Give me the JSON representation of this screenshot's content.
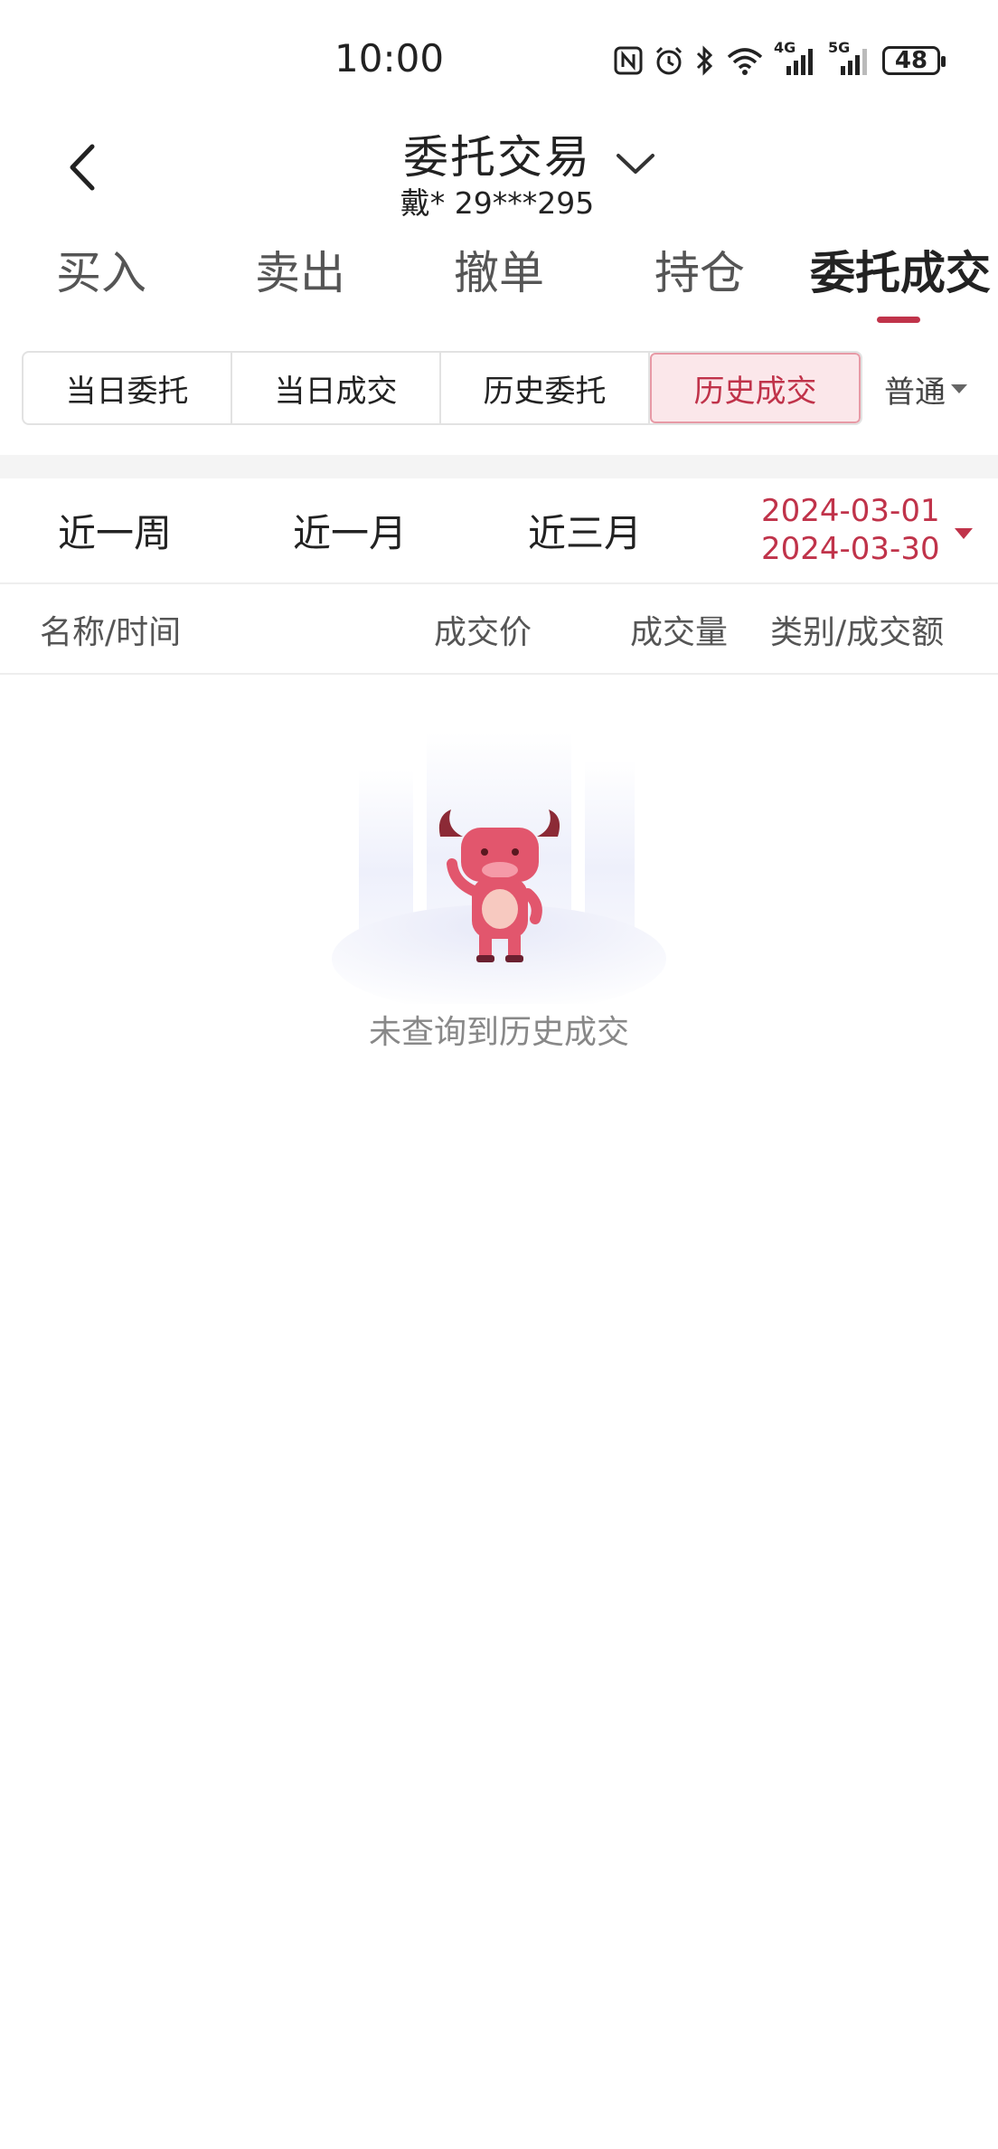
{
  "status_bar": {
    "time": "10:00",
    "icons": [
      "nfc-icon",
      "alarm-icon",
      "bluetooth-icon",
      "wifi-icon",
      "signal-4g-icon",
      "signal-5g-icon"
    ],
    "network_4g": "4G",
    "network_5g": "5G",
    "battery": "48"
  },
  "header": {
    "title": "委托交易",
    "account": "戴* 29***295"
  },
  "main_tabs": [
    "买入",
    "卖出",
    "撤单",
    "持仓",
    "委托成交"
  ],
  "active_main_tab": "委托成交",
  "sub_tabs": [
    "当日委托",
    "当日成交",
    "历史委托",
    "历史成交"
  ],
  "active_sub_tab": "历史成交",
  "account_type": "普通",
  "periods": [
    "近一周",
    "近一月",
    "近三月"
  ],
  "date_range": {
    "start": "2024-03-01",
    "end": "2024-03-30"
  },
  "columns": [
    "名称/时间",
    "成交价",
    "成交量",
    "类别/成交额"
  ],
  "empty_message": "未查询到历史成交",
  "colors": {
    "accent": "#c0334a",
    "active_bg": "#fbe7ea"
  }
}
